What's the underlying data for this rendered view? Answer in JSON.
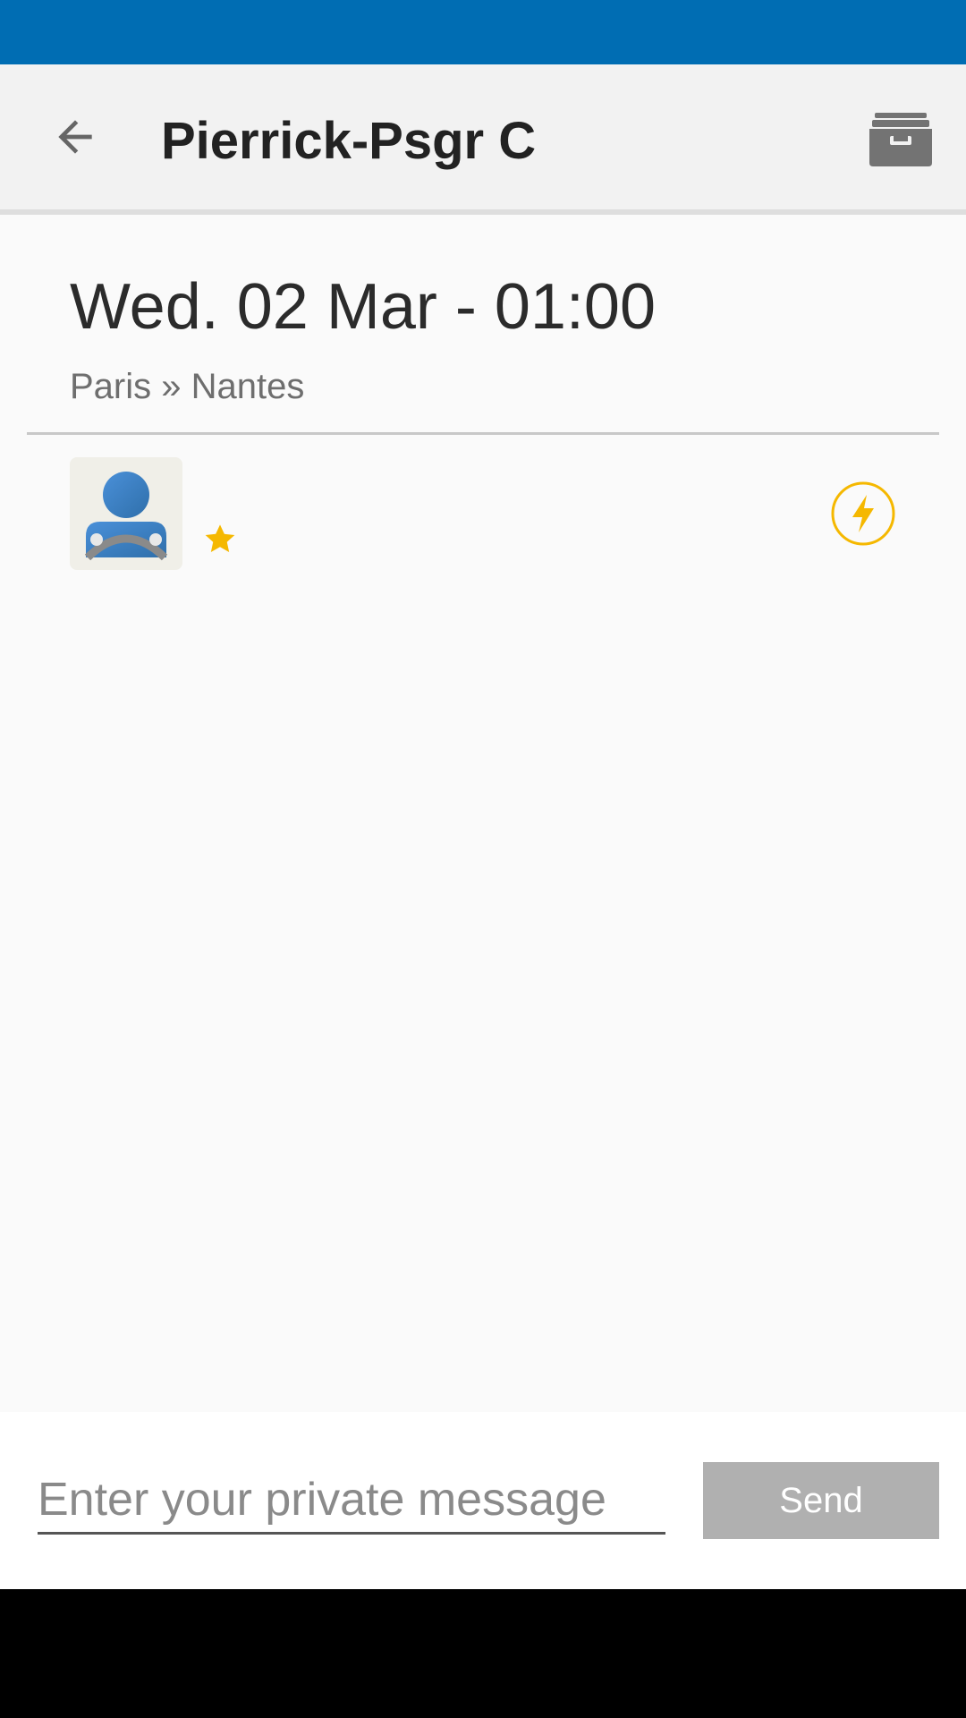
{
  "toolbar": {
    "title": "Pierrick-Psgr C",
    "back_icon": "arrow-back-icon",
    "archive_icon": "archive-icon"
  },
  "trip": {
    "date": "Wed. 02 Mar - 01:00",
    "route": "Paris » Nantes"
  },
  "driver": {
    "avatar_icon": "driver-avatar-icon",
    "star_icon": "star-icon",
    "instant_icon": "instant-booking-icon"
  },
  "compose": {
    "placeholder": "Enter your private message",
    "send_label": "Send"
  },
  "colors": {
    "status_bar": "#006db3",
    "app_bar": "#f2f2f2",
    "accent_yellow": "#f5b800",
    "avatar_blue": "#3f88c5",
    "send_disabled": "#b0b0b0"
  }
}
